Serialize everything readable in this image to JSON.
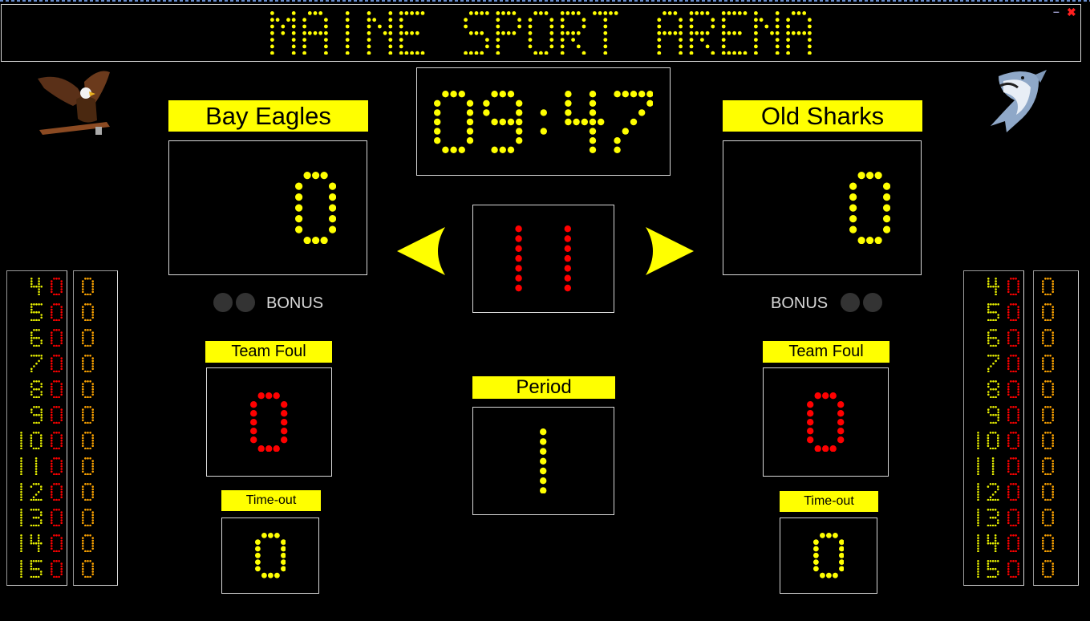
{
  "title": "MAINE SPORT ARENA",
  "window": {
    "minimize_icon": "minimize-icon",
    "close_icon": "close-icon",
    "minimize": "–",
    "close": "✖"
  },
  "colors": {
    "digit_yellow": "#ffff00",
    "digit_red": "#ff0000",
    "label_bg": "#ffff00",
    "points_orange": "#ffa500"
  },
  "clock": "09:47",
  "shot_clock": "11",
  "period": {
    "label": "Period",
    "value": "1"
  },
  "possession": {
    "left_arrow_icon": "arrow-left-icon",
    "right_arrow_icon": "arrow-right-icon"
  },
  "home": {
    "name": "Bay Eagles",
    "logo": "eagle-logo",
    "score": "0",
    "bonus_label": "BONUS",
    "team_foul_label": "Team Foul",
    "team_fouls": "0",
    "timeout_label": "Time-out",
    "timeouts": "0",
    "players": [
      {
        "number": "4",
        "fouls": "0",
        "points": "0"
      },
      {
        "number": "5",
        "fouls": "0",
        "points": "0"
      },
      {
        "number": "6",
        "fouls": "0",
        "points": "0"
      },
      {
        "number": "7",
        "fouls": "0",
        "points": "0"
      },
      {
        "number": "8",
        "fouls": "0",
        "points": "0"
      },
      {
        "number": "9",
        "fouls": "0",
        "points": "0"
      },
      {
        "number": "10",
        "fouls": "0",
        "points": "0"
      },
      {
        "number": "11",
        "fouls": "0",
        "points": "0"
      },
      {
        "number": "12",
        "fouls": "0",
        "points": "0"
      },
      {
        "number": "13",
        "fouls": "0",
        "points": "0"
      },
      {
        "number": "14",
        "fouls": "0",
        "points": "0"
      },
      {
        "number": "15",
        "fouls": "0",
        "points": "0"
      }
    ]
  },
  "guest": {
    "name": "Old Sharks",
    "logo": "shark-logo",
    "score": "0",
    "bonus_label": "BONUS",
    "team_foul_label": "Team Foul",
    "team_fouls": "0",
    "timeout_label": "Time-out",
    "timeouts": "0",
    "players": [
      {
        "number": "4",
        "fouls": "0",
        "points": "0"
      },
      {
        "number": "5",
        "fouls": "0",
        "points": "0"
      },
      {
        "number": "6",
        "fouls": "0",
        "points": "0"
      },
      {
        "number": "7",
        "fouls": "0",
        "points": "0"
      },
      {
        "number": "8",
        "fouls": "0",
        "points": "0"
      },
      {
        "number": "9",
        "fouls": "0",
        "points": "0"
      },
      {
        "number": "10",
        "fouls": "0",
        "points": "0"
      },
      {
        "number": "11",
        "fouls": "0",
        "points": "0"
      },
      {
        "number": "12",
        "fouls": "0",
        "points": "0"
      },
      {
        "number": "13",
        "fouls": "0",
        "points": "0"
      },
      {
        "number": "14",
        "fouls": "0",
        "points": "0"
      },
      {
        "number": "15",
        "fouls": "0",
        "points": "0"
      }
    ]
  }
}
